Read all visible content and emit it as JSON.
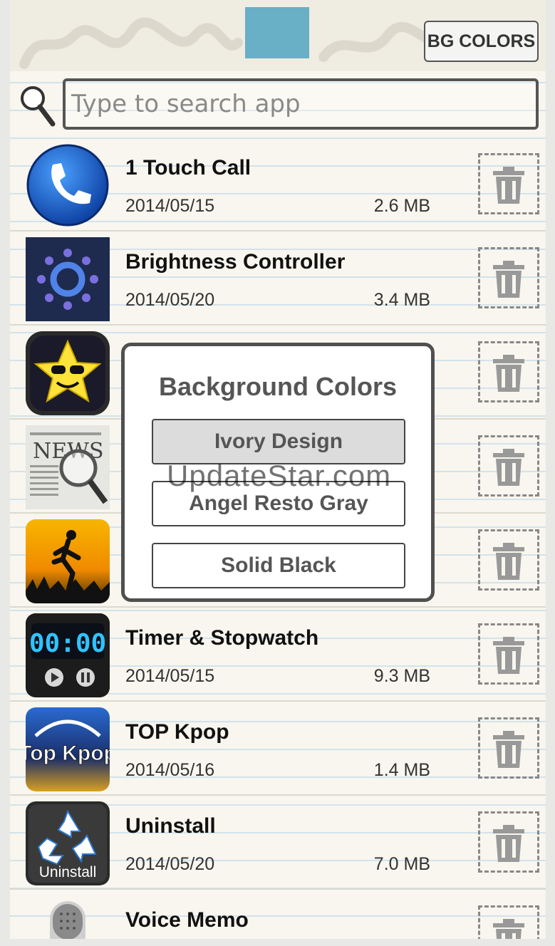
{
  "header": {
    "bg_colors_label": "BG COLORS",
    "search_placeholder": "Type to search app"
  },
  "apps": [
    {
      "name": "1 Touch Call",
      "date": "2014/05/15",
      "size": "2.6 MB",
      "icon": "phone-icon"
    },
    {
      "name": "Brightness Controller",
      "date": "2014/05/20",
      "size": "3.4 MB",
      "icon": "brightness-icon"
    },
    {
      "name": "",
      "date": "",
      "size": "",
      "icon": "star-sunglasses-icon"
    },
    {
      "name": "",
      "date": "",
      "size": "",
      "icon": "news-icon"
    },
    {
      "name": "",
      "date": "",
      "size": "",
      "icon": "runner-icon"
    },
    {
      "name": "Timer & Stopwatch",
      "date": "2014/05/15",
      "size": "9.3 MB",
      "icon": "timer-icon",
      "icon_text": "00:00"
    },
    {
      "name": "TOP Kpop",
      "date": "2014/05/16",
      "size": "1.4 MB",
      "icon": "kpop-icon",
      "icon_text": "Top Kpop"
    },
    {
      "name": "Uninstall",
      "date": "2014/05/20",
      "size": "7.0 MB",
      "icon": "recycle-icon",
      "icon_text": "Uninstall"
    },
    {
      "name": "Voice Memo",
      "date": "",
      "size": "",
      "icon": "microphone-icon"
    }
  ],
  "dialog": {
    "title": "Background Colors",
    "options": [
      "Ivory Design",
      "Angel Resto Gray",
      "Solid Black"
    ],
    "selected": "Ivory Design"
  },
  "watermark": "UpdateStar.com",
  "colors": {
    "background": "#f8f6ee",
    "tape": "#5aa9c2",
    "border": "#555555",
    "selected_option": "#dcdcdc"
  }
}
